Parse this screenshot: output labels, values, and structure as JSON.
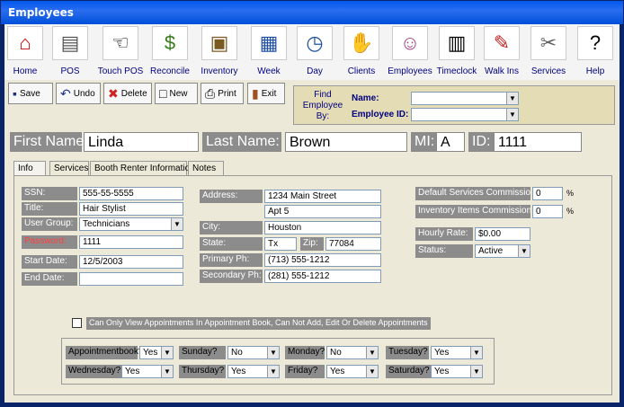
{
  "window": {
    "title": "Employees"
  },
  "nav": [
    "Home",
    "POS",
    "Touch POS",
    "Reconcile",
    "Inventory",
    "Week",
    "Day",
    "Clients",
    "Employees",
    "Timeclock",
    "Walk Ins",
    "Services",
    "Help"
  ],
  "toolbar": {
    "save": "Save",
    "undo": "Undo",
    "delete": "Delete",
    "new": "New",
    "print": "Print",
    "exit": "Exit"
  },
  "finder": {
    "label": "Find Employee By:",
    "name_label": "Name:",
    "id_label": "Employee ID:",
    "name_value": "",
    "id_value": ""
  },
  "header": {
    "first_name_label": "First Name",
    "first_name": "Linda",
    "last_name_label": "Last Name:",
    "last_name": "Brown",
    "mi_label": "MI:",
    "mi": "A",
    "id_label": "ID:",
    "id": "1111"
  },
  "tabs": [
    "Info",
    "Services",
    "Booth Renter Information",
    "Notes"
  ],
  "info": {
    "ssn_label": "SSN:",
    "ssn": "555-55-5555",
    "title_label": "Title:",
    "title": "Hair Stylist",
    "group_label": "User Group:",
    "group": "Technicians",
    "password_label": "Password:",
    "password": "1111",
    "start_label": "Start Date:",
    "start": "12/5/2003",
    "end_label": "End Date:",
    "end": "",
    "address_label": "Address:",
    "address1": "1234 Main Street",
    "address2": "Apt 5",
    "city_label": "City:",
    "city": "Houston",
    "state_label": "State:",
    "state": "Tx",
    "zip_label": "Zip:",
    "zip": "77084",
    "primary_label": "Primary Ph:",
    "primary": "(713) 555-1212",
    "secondary_label": "Secondary Ph:",
    "secondary": "(281) 555-1212",
    "svc_comm_label": "Default Services Commission:",
    "svc_comm": "0",
    "pct1": "%",
    "inv_comm_label": "Inventory Items Commission:",
    "inv_comm": "0",
    "pct2": "%",
    "rate_label": "Hourly Rate:",
    "rate": "$0.00",
    "status_label": "Status:",
    "status": "Active",
    "restrict_label": "Can Only View Appointments In Appointment Book, Can Not Add, Edit Or Delete Appointments"
  },
  "days": [
    {
      "label": "Appointmentbook?",
      "value": "Yes"
    },
    {
      "label": "Sunday?",
      "value": "No"
    },
    {
      "label": "Monday?",
      "value": "No"
    },
    {
      "label": "Tuesday?",
      "value": "Yes"
    },
    {
      "label": "Wednesday?",
      "value": "Yes"
    },
    {
      "label": "Thursday?",
      "value": "Yes"
    },
    {
      "label": "Friday?",
      "value": "Yes"
    },
    {
      "label": "Saturday?",
      "value": "Yes"
    }
  ]
}
